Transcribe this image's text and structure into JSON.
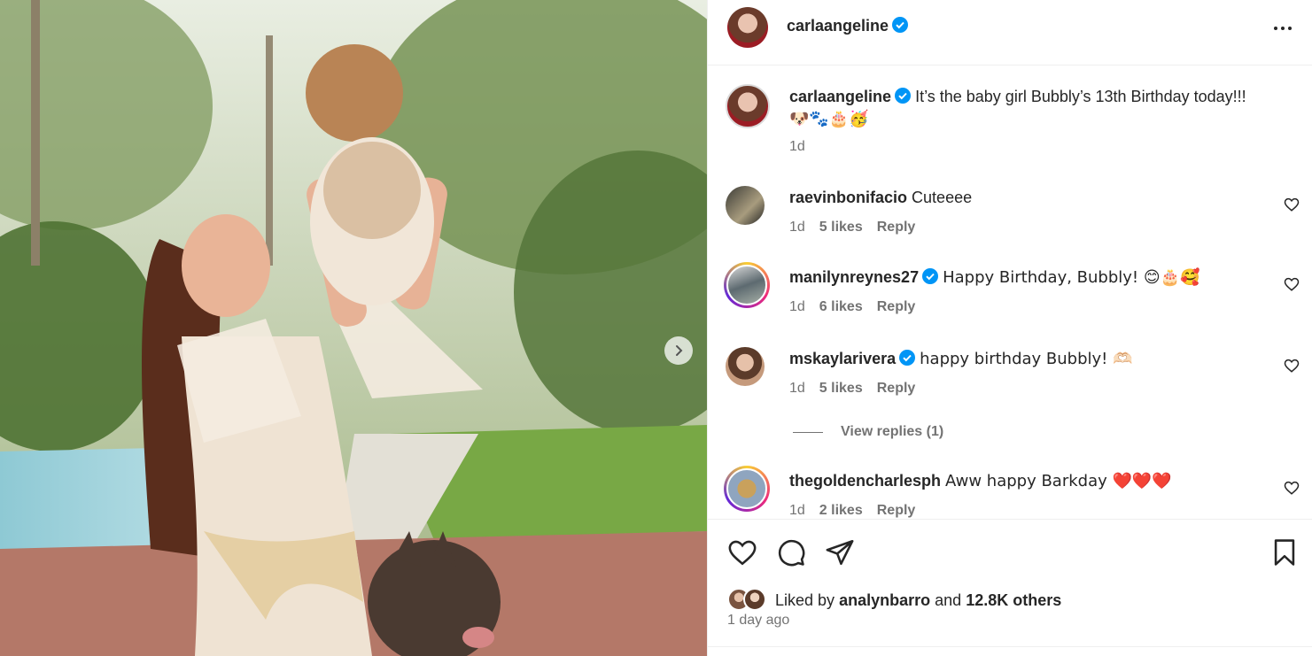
{
  "post": {
    "author": "carlaangeline",
    "author_verified": true,
    "caption_text": "It’s the baby girl Bubbly’s 13th Birthday today!!!",
    "caption_emojis": "🐶🐾🎂🥳",
    "caption_time": "1d"
  },
  "comments": [
    {
      "username": "raevinbonifacio",
      "verified": false,
      "text": "Cuteeee",
      "time": "1d",
      "likes": "5 likes",
      "reply": "Reply"
    },
    {
      "username": "manilynreynes27",
      "verified": true,
      "text": "Happy Birthday, Bubbly! 😊🎂🥰",
      "time": "1d",
      "likes": "6 likes",
      "reply": "Reply"
    },
    {
      "username": "mskaylarivera",
      "verified": true,
      "text": "happy birthday Bubbly! 🫶🏻",
      "time": "1d",
      "likes": "5 likes",
      "reply": "Reply",
      "view_replies": "View replies (1)"
    },
    {
      "username": "thegoldencharlesph",
      "verified": false,
      "text": "Aww happy Barkday ❤️❤️❤️",
      "time": "1d",
      "likes": "2 likes",
      "reply": "Reply"
    }
  ],
  "likes": {
    "prefix": "Liked by",
    "liker": "analynbarro",
    "joiner": "and",
    "others": "12.8K others"
  },
  "post_age": "1 day ago",
  "colors": {
    "verified": "#0095f6",
    "text": "#262626",
    "muted": "#737373"
  },
  "icons": [
    "more-icon",
    "heart-icon",
    "comment-icon",
    "share-icon",
    "bookmark-icon",
    "chevron-right-icon",
    "verified-icon"
  ]
}
